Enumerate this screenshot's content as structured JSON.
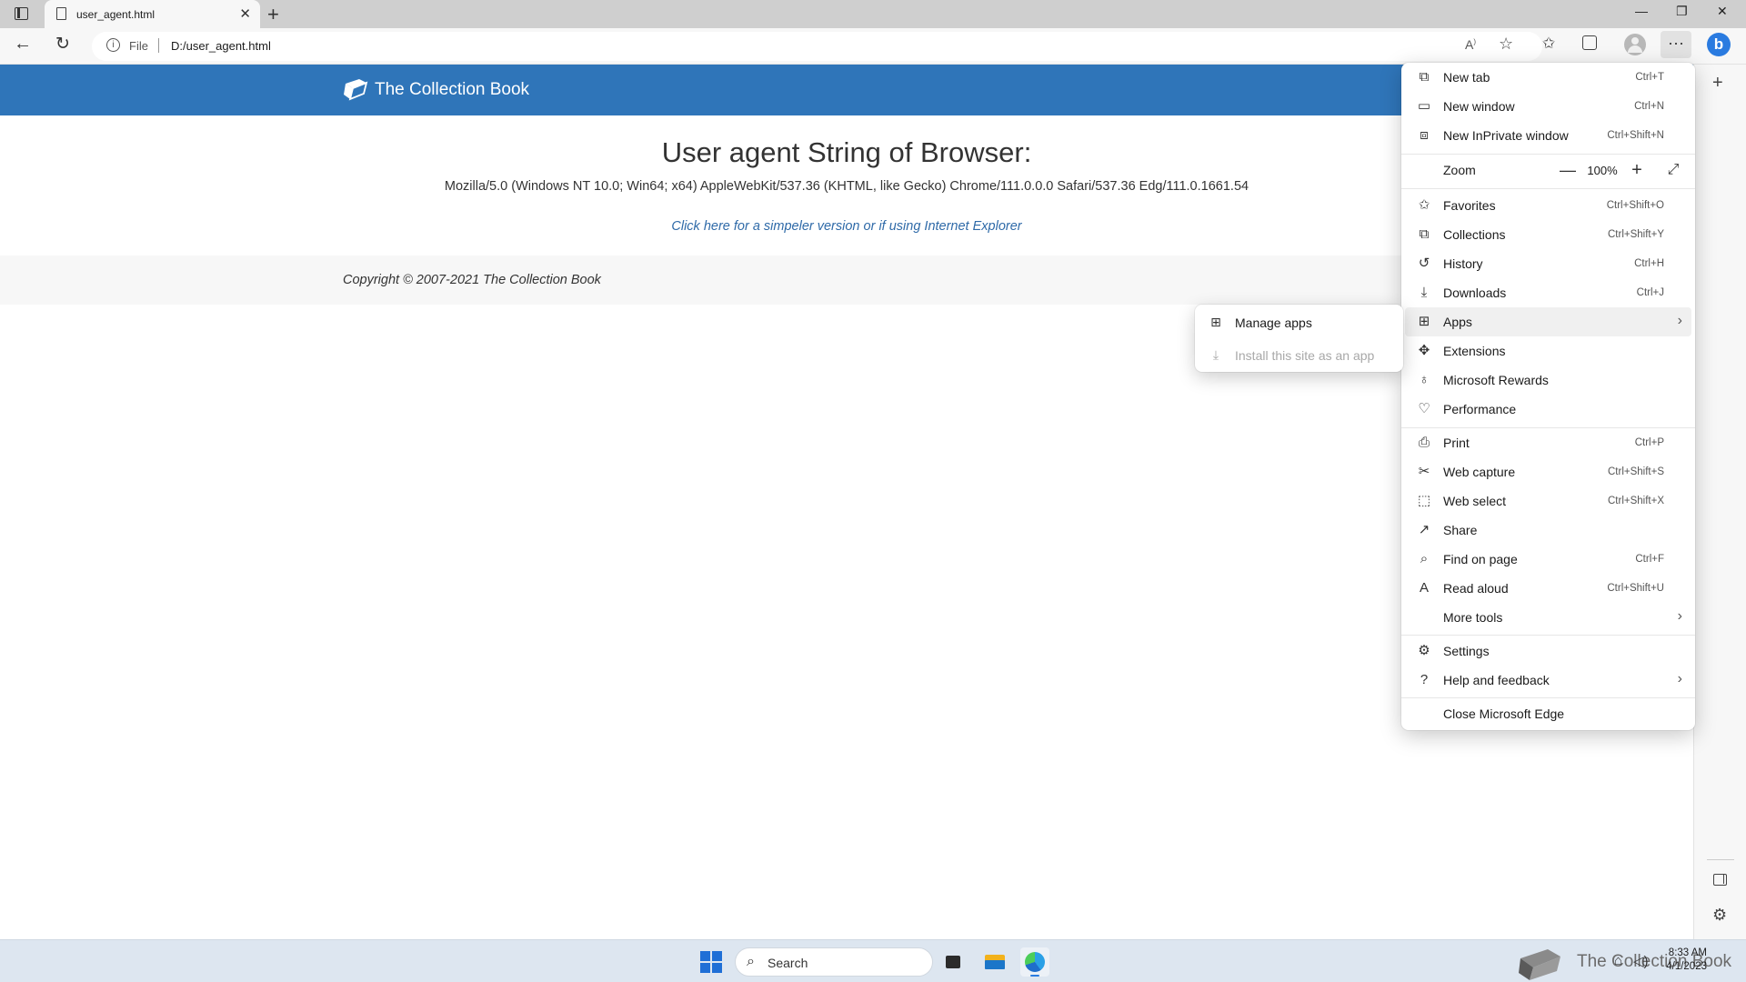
{
  "browser": {
    "tab_title": "user_agent.html",
    "tab_close": "✕",
    "new_tab": "+",
    "window_controls": {
      "minimize": "—",
      "restore": "❐",
      "close": "✕"
    },
    "address_label": "File",
    "url": "D:/user_agent.html"
  },
  "page": {
    "brand": "The Collection Book",
    "title": "User agent String of Browser:",
    "user_agent": "Mozilla/5.0 (Windows NT 10.0; Win64; x64) AppleWebKit/537.36 (KHTML, like Gecko) Chrome/111.0.0.0 Safari/537.36 Edg/111.0.1661.54",
    "simpler_link": "Click here for a simpeler version or if using Internet Explorer",
    "copyright": "Copyright © 2007-2021 The Collection Book",
    "header_color": "#2f75b9"
  },
  "menu": {
    "items": [
      {
        "label": "New tab",
        "shortcut": "Ctrl+T",
        "icon": "new-tab-icon"
      },
      {
        "label": "New window",
        "shortcut": "Ctrl+N",
        "icon": "new-window-icon"
      },
      {
        "label": "New InPrivate window",
        "shortcut": "Ctrl+Shift+N",
        "icon": "inprivate-icon"
      },
      {
        "label": "Zoom",
        "icon": ""
      },
      {
        "label": "Favorites",
        "shortcut": "Ctrl+Shift+O",
        "icon": "favorites-icon"
      },
      {
        "label": "Collections",
        "shortcut": "Ctrl+Shift+Y",
        "icon": "collections-icon"
      },
      {
        "label": "History",
        "shortcut": "Ctrl+H",
        "icon": "history-icon"
      },
      {
        "label": "Downloads",
        "shortcut": "Ctrl+J",
        "icon": "downloads-icon"
      },
      {
        "label": "Apps",
        "icon": "apps-icon"
      },
      {
        "label": "Extensions",
        "icon": "extensions-icon"
      },
      {
        "label": "Microsoft Rewards",
        "icon": "rewards-icon"
      },
      {
        "label": "Performance",
        "icon": "performance-icon"
      },
      {
        "label": "Print",
        "shortcut": "Ctrl+P",
        "icon": "print-icon"
      },
      {
        "label": "Web capture",
        "shortcut": "Ctrl+Shift+S",
        "icon": "web-capture-icon"
      },
      {
        "label": "Web select",
        "shortcut": "Ctrl+Shift+X",
        "icon": "web-select-icon"
      },
      {
        "label": "Share",
        "icon": "share-icon"
      },
      {
        "label": "Find on page",
        "shortcut": "Ctrl+F",
        "icon": "find-icon"
      },
      {
        "label": "Read aloud",
        "shortcut": "Ctrl+Shift+U",
        "icon": "read-aloud-icon"
      },
      {
        "label": "More tools",
        "icon": ""
      },
      {
        "label": "Settings",
        "icon": "settings-icon"
      },
      {
        "label": "Help and feedback",
        "icon": "help-icon"
      },
      {
        "label": "Close Microsoft Edge",
        "icon": ""
      }
    ],
    "zoom_value": "100%",
    "zoom_minus": "—",
    "zoom_plus": "+"
  },
  "apps_submenu": {
    "items": [
      {
        "label": "Manage apps",
        "enabled": true,
        "icon": "apps-grid-icon"
      },
      {
        "label": "Install this site as an app",
        "enabled": false,
        "icon": "install-icon"
      }
    ]
  },
  "taskbar": {
    "search_placeholder": "Search",
    "time": "8:33 AM",
    "date": "4/1/2023",
    "watermark": "The Collection Book"
  }
}
